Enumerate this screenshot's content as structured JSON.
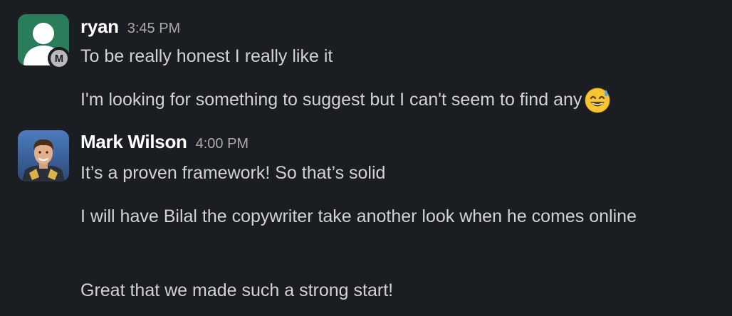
{
  "messages": [
    {
      "author": "ryan",
      "time": "3:45 PM",
      "badge": "M",
      "lines": [
        "To be really honest I really like it",
        "I'm looking for something to suggest but I can't seem to find any"
      ],
      "emoji": "grinning-face-with-sweat"
    },
    {
      "author": "Mark Wilson",
      "time": "4:00 PM",
      "lines": [
        "It’s a proven framework! So that’s solid",
        "I will have Bilal the copywriter take another look when he comes online",
        "Great that we made such a strong start!"
      ]
    }
  ],
  "colors": {
    "background": "#1a1d21",
    "text": "#d1d2d3",
    "author": "#ffffff",
    "timestamp": "#ababad",
    "ryan_avatar": "#2a7d5a"
  }
}
